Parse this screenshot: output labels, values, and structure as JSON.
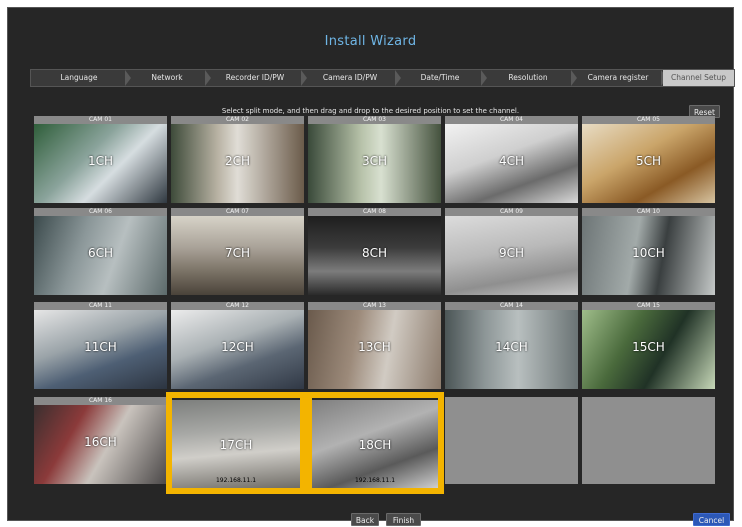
{
  "window": {
    "title": "Install Wizard"
  },
  "steps": [
    {
      "label": "Language"
    },
    {
      "label": "Network"
    },
    {
      "label": "Recorder ID/PW"
    },
    {
      "label": "Camera ID/PW"
    },
    {
      "label": "Date/Time"
    },
    {
      "label": "Resolution"
    },
    {
      "label": "Camera register"
    },
    {
      "label": "Channel Setup",
      "active": true
    }
  ],
  "instruction": "Select split mode, and then drag and drop to the desired position to set the channel.",
  "buttons": {
    "reset": "Reset",
    "back": "Back",
    "finish": "Finish",
    "cancel": "Cancel"
  },
  "tiles": [
    {
      "cam": "CAM 01",
      "ch": "1CH"
    },
    {
      "cam": "CAM 02",
      "ch": "2CH"
    },
    {
      "cam": "CAM 03",
      "ch": "3CH"
    },
    {
      "cam": "CAM 04",
      "ch": "4CH"
    },
    {
      "cam": "CAM 05",
      "ch": "5CH"
    },
    {
      "cam": "CAM 06",
      "ch": "6CH"
    },
    {
      "cam": "CAM 07",
      "ch": "7CH"
    },
    {
      "cam": "CAM 08",
      "ch": "8CH"
    },
    {
      "cam": "CAM 09",
      "ch": "9CH"
    },
    {
      "cam": "CAM 10",
      "ch": "10CH"
    },
    {
      "cam": "CAM 11",
      "ch": "11CH"
    },
    {
      "cam": "CAM 12",
      "ch": "12CH"
    },
    {
      "cam": "CAM 13",
      "ch": "13CH"
    },
    {
      "cam": "CAM 14",
      "ch": "14CH"
    },
    {
      "cam": "CAM 15",
      "ch": "15CH"
    },
    {
      "cam": "CAM 16",
      "ch": "16CH"
    },
    {
      "cam": "",
      "ch": "17CH",
      "ip": "192.168.11.1"
    },
    {
      "cam": "",
      "ch": "18CH",
      "ip": "192.168.11.1"
    },
    {
      "cam": "",
      "ch": ""
    },
    {
      "cam": "",
      "ch": ""
    }
  ],
  "colors": {
    "accent_title": "#6fb6e6",
    "highlight": "#f3b400",
    "cancel_button": "#2c58b7"
  }
}
